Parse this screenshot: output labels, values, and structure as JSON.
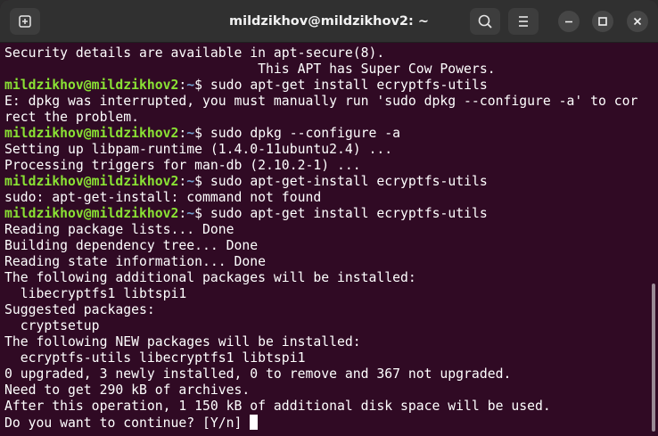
{
  "window": {
    "title": "mildzikhov@mildzikhov2: ~"
  },
  "icons": {
    "new_tab": "new-tab-icon",
    "search": "search-icon",
    "menu": "hamburger-menu-icon",
    "minimize": "minimize-icon",
    "maximize": "maximize-icon",
    "close": "close-icon"
  },
  "colors": {
    "terminal_bg": "#300a24",
    "prompt_user": "#8ae234",
    "prompt_path": "#729fcf",
    "text": "#ffffff"
  },
  "terminal": {
    "prompt_user": "mildzikhov@mildzikhov2",
    "prompt_sep": ":",
    "prompt_path": "~",
    "prompt_suffix": "$ ",
    "lines": [
      {
        "type": "out",
        "text": "Security details are available in apt-secure(8)."
      },
      {
        "type": "out",
        "text": "                                This APT has Super Cow Powers."
      },
      {
        "type": "cmd",
        "text": "sudo apt-get install ecryptfs-utils"
      },
      {
        "type": "out",
        "text": "E: dpkg was interrupted, you must manually run 'sudo dpkg --configure -a' to cor"
      },
      {
        "type": "out",
        "text": "rect the problem."
      },
      {
        "type": "cmd",
        "text": "sudo dpkg --configure -a"
      },
      {
        "type": "out",
        "text": "Setting up libpam-runtime (1.4.0-11ubuntu2.4) ..."
      },
      {
        "type": "out",
        "text": "Processing triggers for man-db (2.10.2-1) ..."
      },
      {
        "type": "cmd",
        "text": "sudo apt-get-install ecryptfs-utils"
      },
      {
        "type": "out",
        "text": "sudo: apt-get-install: command not found"
      },
      {
        "type": "cmd",
        "text": "sudo apt-get install ecryptfs-utils"
      },
      {
        "type": "out",
        "text": "Reading package lists... Done"
      },
      {
        "type": "out",
        "text": "Building dependency tree... Done"
      },
      {
        "type": "out",
        "text": "Reading state information... Done"
      },
      {
        "type": "out",
        "text": "The following additional packages will be installed:"
      },
      {
        "type": "out",
        "text": "  libecryptfs1 libtspi1"
      },
      {
        "type": "out",
        "text": "Suggested packages:"
      },
      {
        "type": "out",
        "text": "  cryptsetup"
      },
      {
        "type": "out",
        "text": "The following NEW packages will be installed:"
      },
      {
        "type": "out",
        "text": "  ecryptfs-utils libecryptfs1 libtspi1"
      },
      {
        "type": "out",
        "text": "0 upgraded, 3 newly installed, 0 to remove and 367 not upgraded."
      },
      {
        "type": "out",
        "text": "Need to get 290 kB of archives."
      },
      {
        "type": "out",
        "text": "After this operation, 1 150 kB of additional disk space will be used."
      },
      {
        "type": "input",
        "text": "Do you want to continue? [Y/n] "
      }
    ]
  }
}
